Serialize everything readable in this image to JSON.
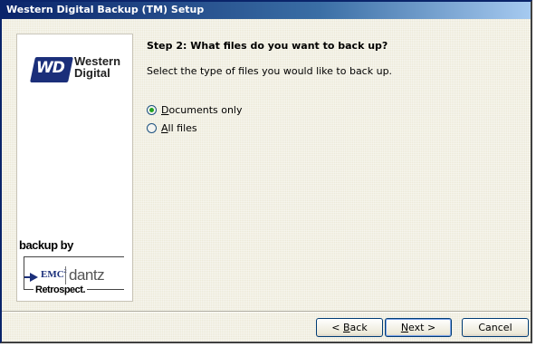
{
  "window": {
    "title": "Western Digital Backup (TM) Setup"
  },
  "branding": {
    "wd_badge": "WD",
    "wd_name_line1": "Western",
    "wd_name_line2": "Digital",
    "backup_by": "backup by",
    "emc": "EMC",
    "dantz": "dantz",
    "retrospect": "Retrospect."
  },
  "step": {
    "title": "Step 2: What files do you want to back up?",
    "description": "Select the type of files you would like to back up."
  },
  "options": [
    {
      "label_mnemonic": "D",
      "label_rest": "ocuments only",
      "selected": true
    },
    {
      "label_mnemonic": "A",
      "label_rest": "ll files",
      "selected": false
    }
  ],
  "buttons": {
    "back_prefix": "< ",
    "back_mnemonic": "B",
    "back_rest": "ack",
    "next_mnemonic": "N",
    "next_rest": "ext >",
    "cancel": "Cancel"
  }
}
